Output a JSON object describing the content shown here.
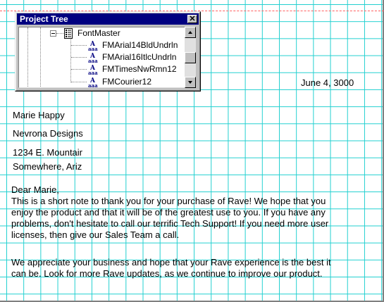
{
  "window": {
    "title": "Project Tree",
    "close_label": "✕"
  },
  "tree": {
    "root": {
      "label": "FontMaster",
      "icon": "report-icon"
    },
    "children": [
      {
        "label": "FMArial14BldUndrln",
        "icon": "font-icon"
      },
      {
        "label": "FMArial16ItlcUndrln",
        "icon": "font-icon"
      },
      {
        "label": "FMTimesNwRmn12",
        "icon": "font-icon"
      },
      {
        "label": "FMCourier12",
        "icon": "font-icon"
      }
    ]
  },
  "letter": {
    "date": "June 4, 3000",
    "recipient_name": "Marie Happy",
    "company": "Nevrona Designs",
    "address1": "1234 E. Mountair",
    "address2": "Somewhere, Ariz",
    "salutation": "Dear Marie,",
    "paragraph1": "This is a short note to thank you for your purchase of Rave! We hope that you\nenjoy the product and that it will be of the greatest use to you. If you have any\nproblems, don't hesitate to call our terrific Tech Support! If you need more user\nlicenses, then give our Sales Team a call.",
    "paragraph2": "We appreciate your business and hope that your Rave experience is the best it\ncan be. Look for more Rave updates, as we continue to improve our product."
  },
  "colors": {
    "grid": "#22d0d0",
    "titlebar": "#000080",
    "margin_line": "#ff6060"
  }
}
